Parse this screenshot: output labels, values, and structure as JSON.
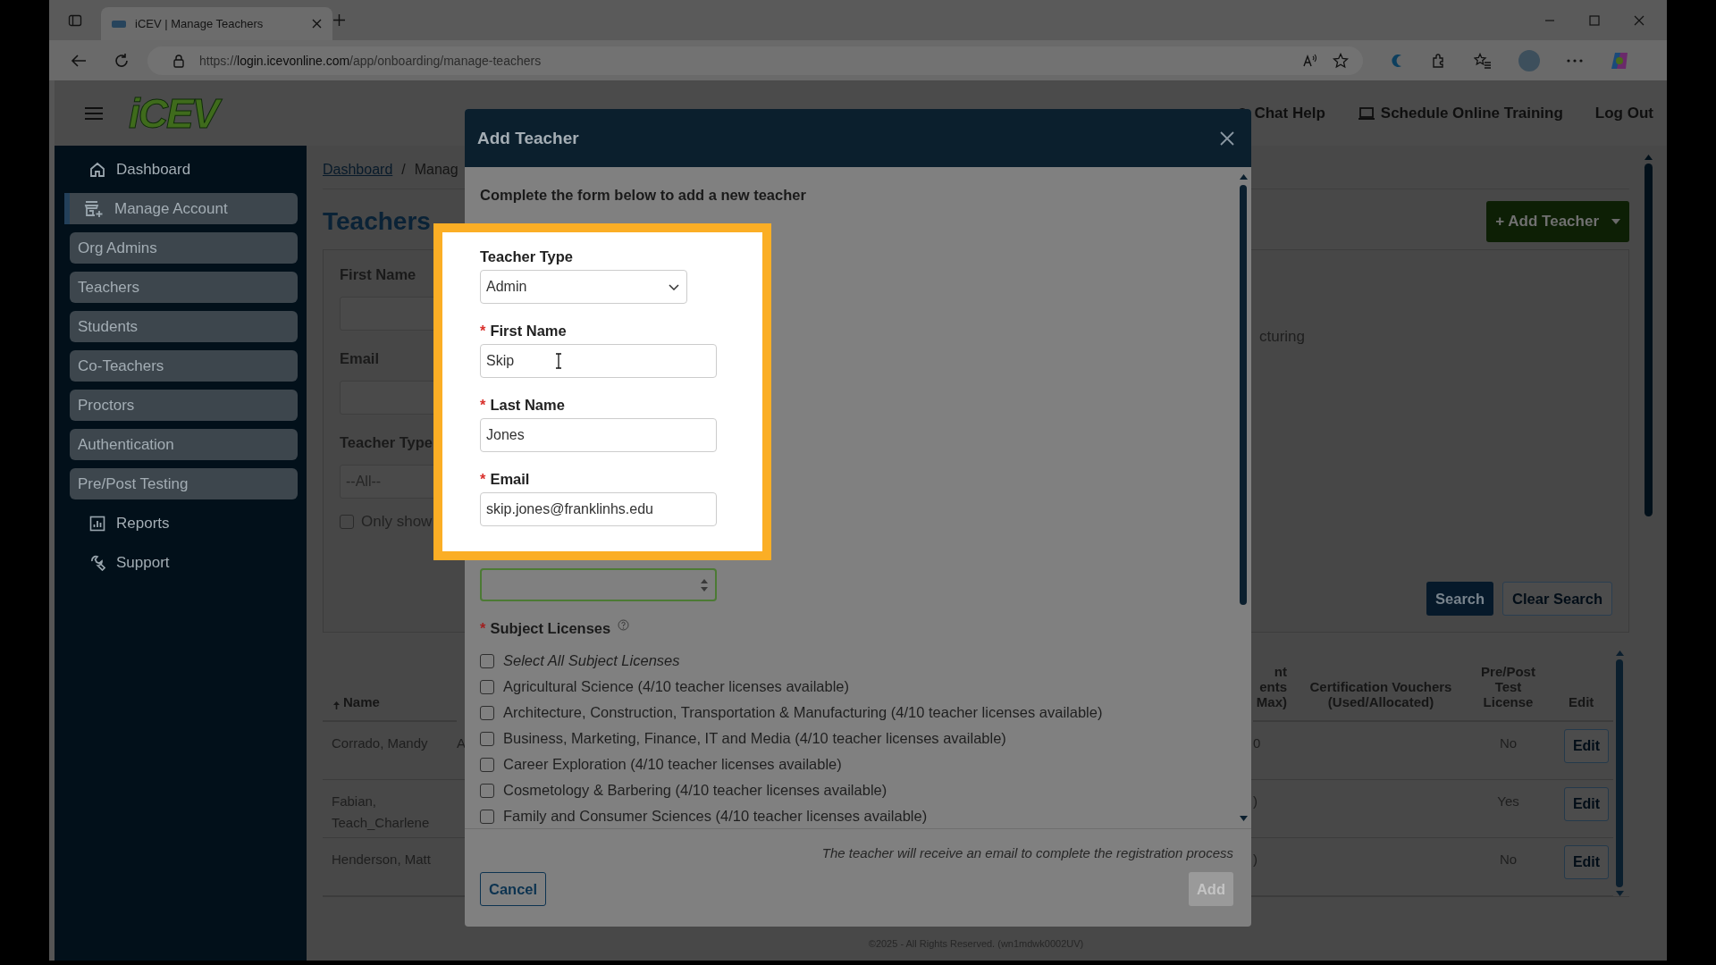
{
  "browser": {
    "tab_title": "iCEV | Manage Teachers",
    "url_scheme": "https://",
    "url_host": "login.icevonline.com",
    "url_path": "/app/onboarding/manage-teachers"
  },
  "header": {
    "logo": "iCEV",
    "nav": [
      "Chat Help",
      "Schedule Online Training",
      "Log Out"
    ]
  },
  "sidebar": {
    "items": [
      {
        "label": "Dashboard",
        "kind": "link",
        "selected": false
      },
      {
        "label": "Manage Account",
        "kind": "link",
        "selected": true
      },
      {
        "label": "Org Admins",
        "kind": "pill",
        "selected": false
      },
      {
        "label": "Teachers",
        "kind": "pill",
        "selected": false
      },
      {
        "label": "Students",
        "kind": "pill",
        "selected": false
      },
      {
        "label": "Co-Teachers",
        "kind": "pill",
        "selected": false
      },
      {
        "label": "Proctors",
        "kind": "pill",
        "selected": false
      },
      {
        "label": "Authentication",
        "kind": "pill",
        "selected": false
      },
      {
        "label": "Pre/Post Testing",
        "kind": "pill",
        "selected": false
      },
      {
        "label": "Reports",
        "kind": "link",
        "selected": false
      },
      {
        "label": "Support",
        "kind": "link",
        "selected": false
      }
    ]
  },
  "breadcrumb": [
    "Dashboard",
    "/",
    "Manag"
  ],
  "page_title": "Teachers",
  "add_button": "+ Add Teacher",
  "filters": {
    "first_name_label": "First Name",
    "email_label": "Email",
    "teacher_type_label": "Teacher Type",
    "teacher_type_value": "--All--",
    "active_only": {
      "label": "Only show",
      "checked": false
    },
    "column_2_text": "cturing",
    "buttons": [
      "Search",
      "Clear Search"
    ]
  },
  "table": {
    "columns": [
      {
        "lines": [
          "Name"
        ],
        "sorted": true
      },
      {
        "lines": [
          "nt",
          "ents",
          "Max)"
        ]
      },
      {
        "lines": [
          "Certification Vouchers",
          "(Used/Allocated)"
        ]
      },
      {
        "lines": [
          "Pre/Post",
          "Test",
          "License"
        ]
      },
      {
        "lines": [
          "Edit"
        ]
      }
    ],
    "rows": [
      {
        "name": "Corrado, Mandy",
        "column_2": "A",
        "column_3": "0",
        "pre_post": "No",
        "action": "Edit"
      },
      {
        "name": "Fabian, Teach_Charlene",
        "column_3": ")",
        "pre_post": "Yes",
        "action": "Edit"
      },
      {
        "name": "Henderson, Matt",
        "column_3": ")",
        "pre_post": "No",
        "action": "Edit"
      }
    ]
  },
  "footer": "©2025 - All Rights Reserved. (wn1mdwk0002UV)",
  "modal": {
    "title": "Add Teacher",
    "required_mark": "*",
    "intro": "Complete the form below to add a new teacher",
    "fields": [
      {
        "label": "Teacher Type",
        "kind": "select",
        "required": false,
        "value": "Admin"
      },
      {
        "label": "First Name",
        "kind": "text",
        "required": true,
        "value": "Skip"
      },
      {
        "label": "Last Name",
        "kind": "text",
        "required": true,
        "value": "Jones"
      },
      {
        "label": "Email",
        "kind": "text",
        "required": true,
        "value": "skip.jones@franklinhs.edu"
      }
    ],
    "licenses": {
      "label": "Subject Licenses",
      "required": true,
      "options": [
        {
          "label": "Select All Subject Licenses",
          "kind": "select_all",
          "checked": false
        },
        {
          "label": "Agricultural Science (4/10 teacher licenses available)",
          "kind": "license",
          "checked": false
        },
        {
          "label": "Architecture, Construction, Transportation & Manufacturing (4/10 teacher licenses available)",
          "kind": "license",
          "checked": false
        },
        {
          "label": "Business, Marketing, Finance, IT and Media (4/10 teacher licenses available)",
          "kind": "license",
          "checked": false
        },
        {
          "label": "Career Exploration (4/10 teacher licenses available)",
          "kind": "license",
          "checked": false
        },
        {
          "label": "Cosmetology & Barbering (4/10 teacher licenses available)",
          "kind": "license",
          "checked": false
        },
        {
          "label": "Family and Consumer Sciences (4/10 teacher licenses available)",
          "kind": "license",
          "checked": false
        }
      ]
    },
    "note": "The teacher will receive an email to complete the registration process",
    "buttons": [
      {
        "label": "Cancel",
        "kind": "secondary",
        "disabled": false
      },
      {
        "label": "Add",
        "kind": "primary",
        "disabled": true
      }
    ]
  }
}
